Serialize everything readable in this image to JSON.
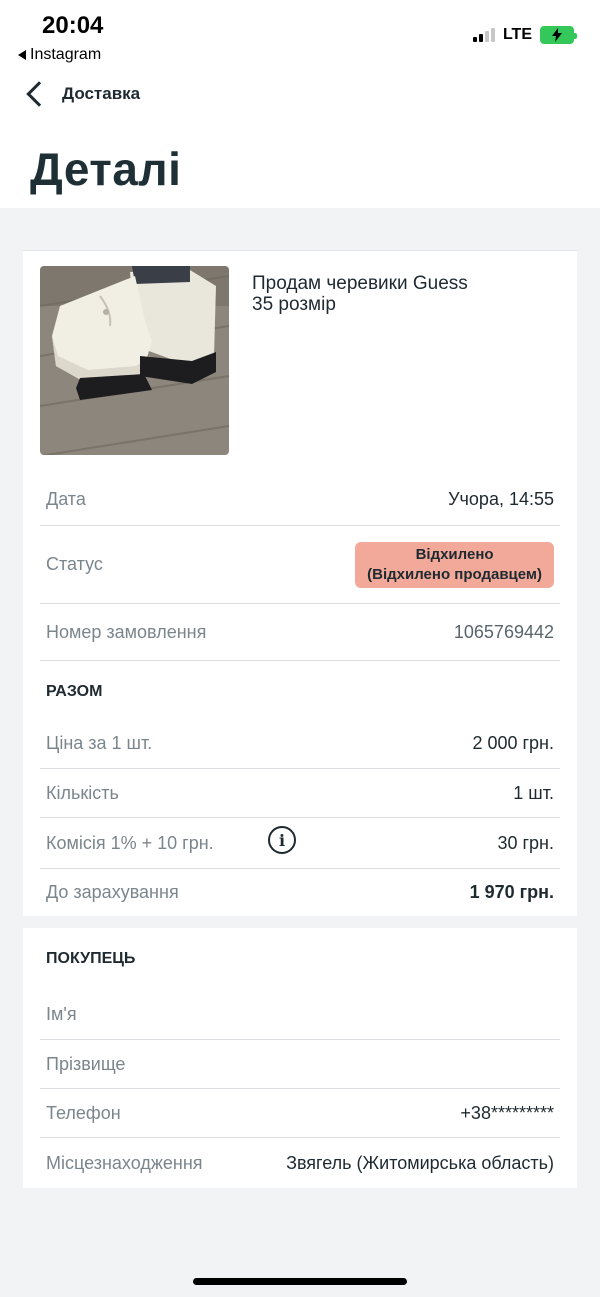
{
  "status_bar": {
    "time": "20:04",
    "back_app": "Instagram",
    "network": "LTE"
  },
  "nav": {
    "back_label": "Доставка"
  },
  "page_title": "Деталі",
  "product": {
    "title_line1": "Продам черевики Guess",
    "title_line2": "35 розмір",
    "image_icon": "boots-photo"
  },
  "details": {
    "date_label": "Дата",
    "date_value": "Учора, 14:55",
    "status_label": "Статус",
    "status_value_line1": "Відхилено",
    "status_value_line2": "(Відхилено продавцем)",
    "order_label": "Номер замовлення",
    "order_value": "1065769442"
  },
  "total": {
    "section_title": "РАЗОМ",
    "price_label": "Ціна за 1 шт.",
    "price_value": "2 000 грн.",
    "qty_label": "Кількість",
    "qty_value": "1 шт.",
    "fee_label": "Комісія 1%  + 10 грн.",
    "fee_icon_glyph": "i",
    "fee_value": "30 грн.",
    "payout_label": "До зарахування",
    "payout_value": "1 970 грн."
  },
  "buyer": {
    "section_title": "ПОКУПЕЦЬ",
    "name_label": "Ім'я",
    "surname_label": "Прізвище",
    "phone_label": "Телефон",
    "phone_value": "+38*********",
    "location_label": "Місцезнаходження",
    "location_value": "Звягель (Житомирська область)"
  },
  "colors": {
    "status_badge_bg": "#f3a99a",
    "text_primary": "#1e2a30",
    "text_secondary": "#7b868c",
    "battery": "#34c759"
  }
}
